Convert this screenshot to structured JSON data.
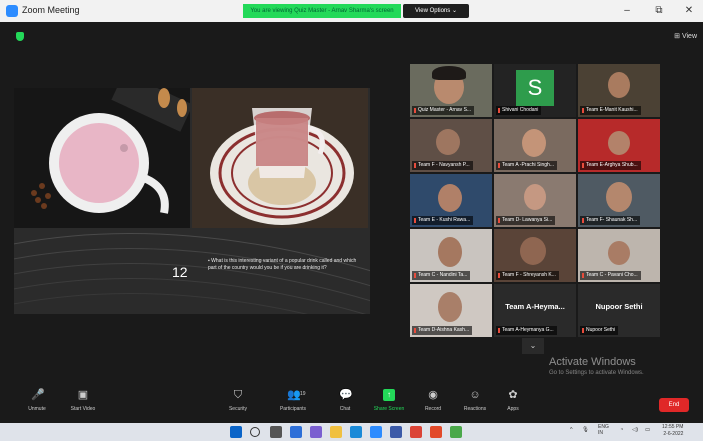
{
  "window": {
    "title": "Zoom Meeting",
    "share_banner": "You are viewing Quiz Master - Arnav Sharma's screen",
    "view_options": "View Options ⌄",
    "minimize": "–",
    "maximize": "⧉",
    "close": "✕"
  },
  "top": {
    "view_label": "View"
  },
  "slide": {
    "number": "12",
    "question": "What is this interesting variant of a popular drink called and which part of the country would you be if you are drinking it?"
  },
  "gallery": {
    "tiles": [
      {
        "name": "Quiz Master - Arnav S..."
      },
      {
        "name": "Shivani Chodani",
        "initial": "S"
      },
      {
        "name": "Team E-Manit Kaushi..."
      },
      {
        "name": "Team F - Navyansh P..."
      },
      {
        "name": "Team A -Prachi Singh..."
      },
      {
        "name": "Team E-Arghya Shub..."
      },
      {
        "name": "Team E - Kushi Rawa..."
      },
      {
        "name": "Team D- Lawanya Si..."
      },
      {
        "name": "Team F- Shaunak Sh..."
      },
      {
        "name": "Team C - Nandini Ta..."
      },
      {
        "name": "Team F - Shreyansh K..."
      },
      {
        "name": "Team C - Pavani Cho..."
      },
      {
        "name": "Team D-Aishna Kash..."
      },
      {
        "name": "Team A-Heymanya G...",
        "big": "Team A-Heyma..."
      },
      {
        "name": "Nupoor Sethi",
        "big": "Nupoor Sethi"
      }
    ],
    "scroll_down": "⌄"
  },
  "watermark": {
    "line1": "Activate Windows",
    "line2": "Go to Settings to activate Windows."
  },
  "toolbar": {
    "unmute": "Unmute",
    "start_video": "Start Video",
    "security": "Security",
    "participants": "Participants",
    "participants_count": "19",
    "chat": "Chat",
    "share_screen": "Share Screen",
    "record": "Record",
    "reactions": "Reactions",
    "apps": "Apps",
    "end": "End"
  },
  "taskbar": {
    "lang": "ENG",
    "lang2": "IN",
    "time": "12:55 PM",
    "date": "2-6-2022"
  },
  "colors": {
    "accent_green": "#23d959",
    "end_red": "#e02828",
    "active_outline": "#c7d84a"
  }
}
